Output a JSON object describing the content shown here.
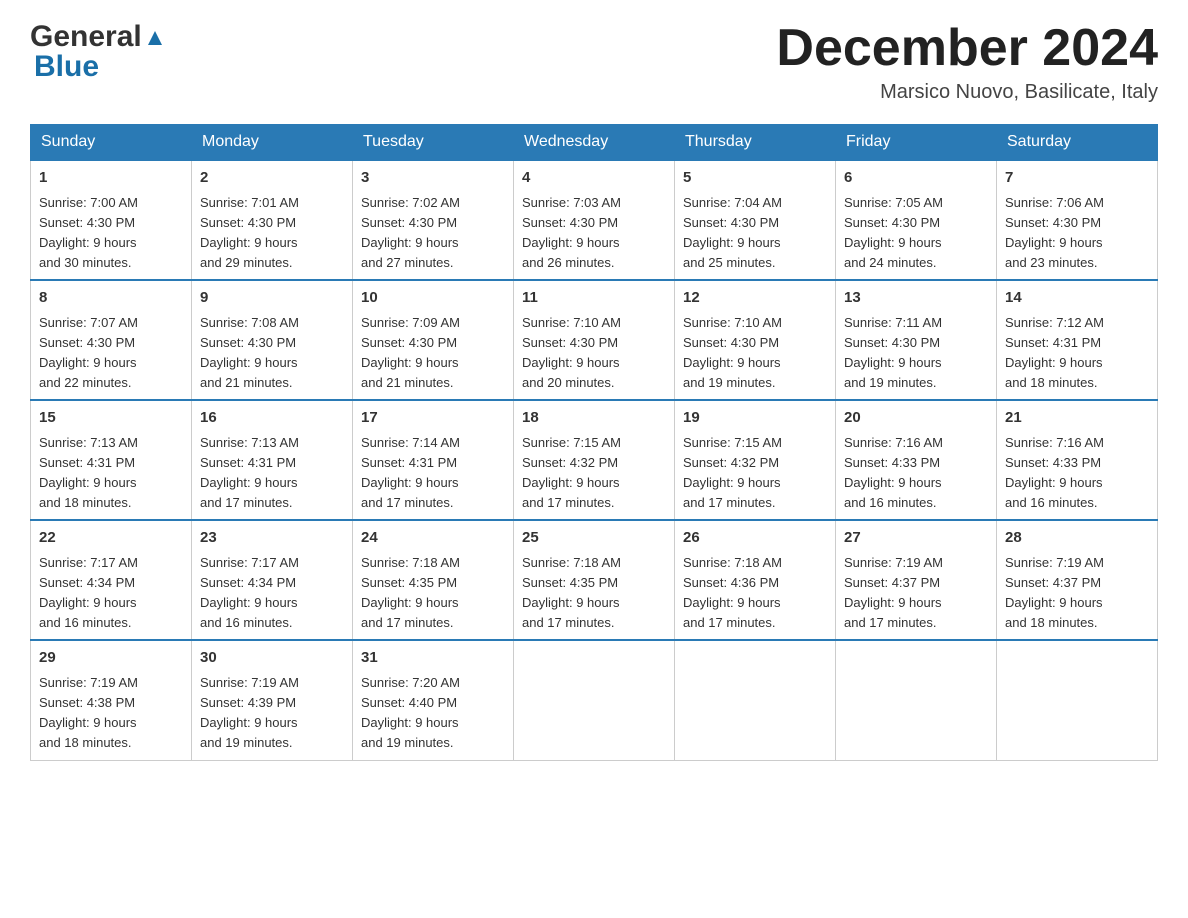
{
  "header": {
    "logo_general": "General",
    "logo_blue": "Blue",
    "month_title": "December 2024",
    "location": "Marsico Nuovo, Basilicate, Italy"
  },
  "days_of_week": [
    "Sunday",
    "Monday",
    "Tuesday",
    "Wednesday",
    "Thursday",
    "Friday",
    "Saturday"
  ],
  "weeks": [
    [
      {
        "day": "1",
        "sunrise": "7:00 AM",
        "sunset": "4:30 PM",
        "daylight": "9 hours and 30 minutes."
      },
      {
        "day": "2",
        "sunrise": "7:01 AM",
        "sunset": "4:30 PM",
        "daylight": "9 hours and 29 minutes."
      },
      {
        "day": "3",
        "sunrise": "7:02 AM",
        "sunset": "4:30 PM",
        "daylight": "9 hours and 27 minutes."
      },
      {
        "day": "4",
        "sunrise": "7:03 AM",
        "sunset": "4:30 PM",
        "daylight": "9 hours and 26 minutes."
      },
      {
        "day": "5",
        "sunrise": "7:04 AM",
        "sunset": "4:30 PM",
        "daylight": "9 hours and 25 minutes."
      },
      {
        "day": "6",
        "sunrise": "7:05 AM",
        "sunset": "4:30 PM",
        "daylight": "9 hours and 24 minutes."
      },
      {
        "day": "7",
        "sunrise": "7:06 AM",
        "sunset": "4:30 PM",
        "daylight": "9 hours and 23 minutes."
      }
    ],
    [
      {
        "day": "8",
        "sunrise": "7:07 AM",
        "sunset": "4:30 PM",
        "daylight": "9 hours and 22 minutes."
      },
      {
        "day": "9",
        "sunrise": "7:08 AM",
        "sunset": "4:30 PM",
        "daylight": "9 hours and 21 minutes."
      },
      {
        "day": "10",
        "sunrise": "7:09 AM",
        "sunset": "4:30 PM",
        "daylight": "9 hours and 21 minutes."
      },
      {
        "day": "11",
        "sunrise": "7:10 AM",
        "sunset": "4:30 PM",
        "daylight": "9 hours and 20 minutes."
      },
      {
        "day": "12",
        "sunrise": "7:10 AM",
        "sunset": "4:30 PM",
        "daylight": "9 hours and 19 minutes."
      },
      {
        "day": "13",
        "sunrise": "7:11 AM",
        "sunset": "4:30 PM",
        "daylight": "9 hours and 19 minutes."
      },
      {
        "day": "14",
        "sunrise": "7:12 AM",
        "sunset": "4:31 PM",
        "daylight": "9 hours and 18 minutes."
      }
    ],
    [
      {
        "day": "15",
        "sunrise": "7:13 AM",
        "sunset": "4:31 PM",
        "daylight": "9 hours and 18 minutes."
      },
      {
        "day": "16",
        "sunrise": "7:13 AM",
        "sunset": "4:31 PM",
        "daylight": "9 hours and 17 minutes."
      },
      {
        "day": "17",
        "sunrise": "7:14 AM",
        "sunset": "4:31 PM",
        "daylight": "9 hours and 17 minutes."
      },
      {
        "day": "18",
        "sunrise": "7:15 AM",
        "sunset": "4:32 PM",
        "daylight": "9 hours and 17 minutes."
      },
      {
        "day": "19",
        "sunrise": "7:15 AM",
        "sunset": "4:32 PM",
        "daylight": "9 hours and 17 minutes."
      },
      {
        "day": "20",
        "sunrise": "7:16 AM",
        "sunset": "4:33 PM",
        "daylight": "9 hours and 16 minutes."
      },
      {
        "day": "21",
        "sunrise": "7:16 AM",
        "sunset": "4:33 PM",
        "daylight": "9 hours and 16 minutes."
      }
    ],
    [
      {
        "day": "22",
        "sunrise": "7:17 AM",
        "sunset": "4:34 PM",
        "daylight": "9 hours and 16 minutes."
      },
      {
        "day": "23",
        "sunrise": "7:17 AM",
        "sunset": "4:34 PM",
        "daylight": "9 hours and 16 minutes."
      },
      {
        "day": "24",
        "sunrise": "7:18 AM",
        "sunset": "4:35 PM",
        "daylight": "9 hours and 17 minutes."
      },
      {
        "day": "25",
        "sunrise": "7:18 AM",
        "sunset": "4:35 PM",
        "daylight": "9 hours and 17 minutes."
      },
      {
        "day": "26",
        "sunrise": "7:18 AM",
        "sunset": "4:36 PM",
        "daylight": "9 hours and 17 minutes."
      },
      {
        "day": "27",
        "sunrise": "7:19 AM",
        "sunset": "4:37 PM",
        "daylight": "9 hours and 17 minutes."
      },
      {
        "day": "28",
        "sunrise": "7:19 AM",
        "sunset": "4:37 PM",
        "daylight": "9 hours and 18 minutes."
      }
    ],
    [
      {
        "day": "29",
        "sunrise": "7:19 AM",
        "sunset": "4:38 PM",
        "daylight": "9 hours and 18 minutes."
      },
      {
        "day": "30",
        "sunrise": "7:19 AM",
        "sunset": "4:39 PM",
        "daylight": "9 hours and 19 minutes."
      },
      {
        "day": "31",
        "sunrise": "7:20 AM",
        "sunset": "4:40 PM",
        "daylight": "9 hours and 19 minutes."
      },
      null,
      null,
      null,
      null
    ]
  ],
  "labels": {
    "sunrise": "Sunrise:",
    "sunset": "Sunset:",
    "daylight": "Daylight:"
  }
}
